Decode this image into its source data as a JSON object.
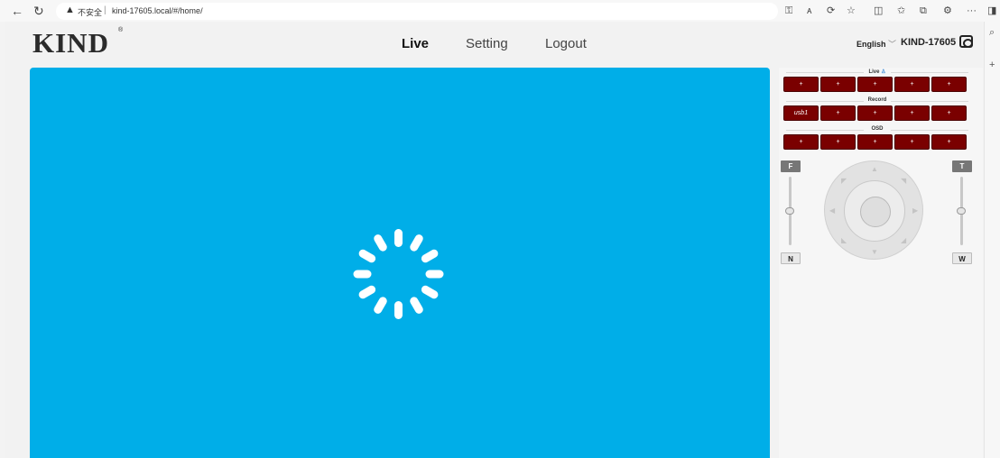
{
  "browser": {
    "insecure_label": "不安全",
    "url": "kind-17605.local/#/home/",
    "more_label": "···"
  },
  "header": {
    "logo": "KIND",
    "logo_mark": "®",
    "nav": [
      "Live",
      "Setting",
      "Logout"
    ],
    "active_nav": "Live",
    "language": "English",
    "device_name": "KIND-17605"
  },
  "panel": {
    "live": {
      "title": "Live",
      "buttons": [
        "+",
        "+",
        "+",
        "+",
        "+"
      ]
    },
    "record": {
      "title": "Record",
      "buttons": [
        "usb1",
        "+",
        "+",
        "+",
        "+"
      ]
    },
    "osd": {
      "title": "OSD",
      "buttons": [
        "+",
        "+",
        "+",
        "+",
        "+"
      ]
    },
    "focus": {
      "top": "F",
      "bottom": "N",
      "level": 0.5
    },
    "zoom": {
      "top": "T",
      "bottom": "W",
      "level": 0.5
    }
  },
  "video": {
    "state": "loading"
  },
  "colors": {
    "video_bg": "#00aee8",
    "button_bg": "#7a0000",
    "page_bg": "#f2f2f2"
  }
}
